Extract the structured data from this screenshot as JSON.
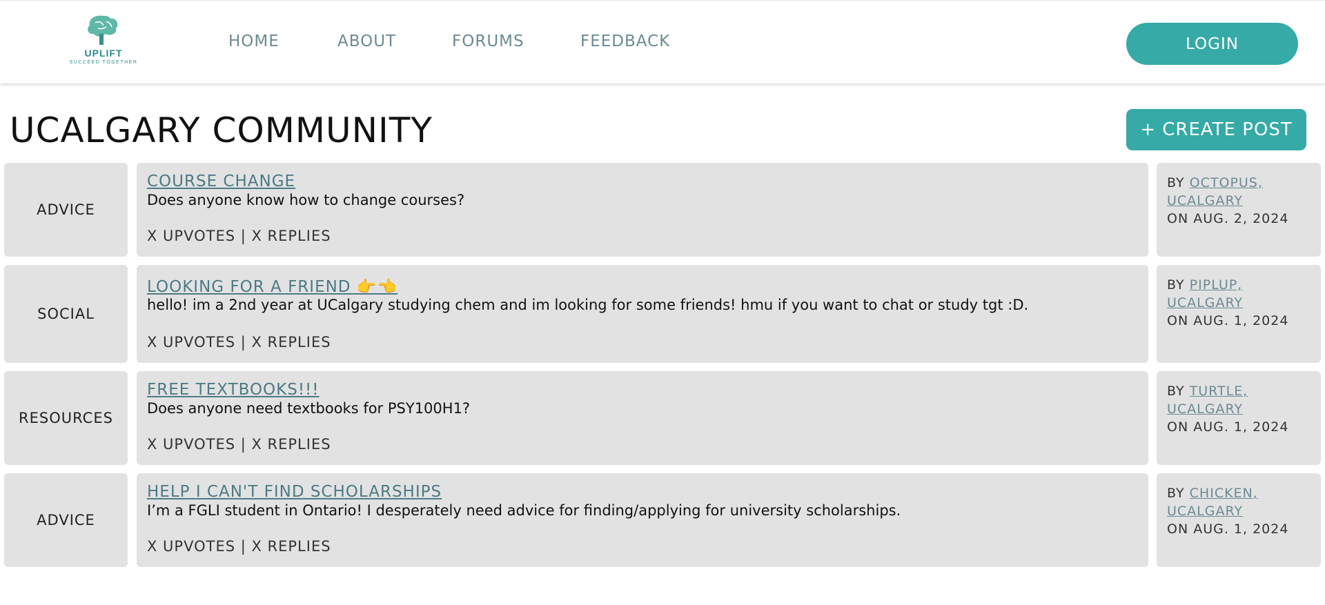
{
  "nav": {
    "logo_name": "UPLIFT",
    "logo_tagline": "SUCCEED TOGETHER",
    "links": [
      "HOME",
      "ABOUT",
      "FORUMS",
      "FEEDBACK"
    ],
    "login_label": "LOGIN"
  },
  "page": {
    "title": "UCALGARY COMMUNITY",
    "create_label": "+ CREATE POST"
  },
  "posts": [
    {
      "category": "ADVICE",
      "title": "COURSE CHANGE",
      "body": "Does anyone know how to change courses?",
      "stats": "X UPVOTES | X REPLIES",
      "by_prefix": "BY",
      "author": "OCTOPUS, UCALGARY",
      "on_prefix": "ON",
      "date": "AUG. 2, 2024"
    },
    {
      "category": "SOCIAL",
      "title": "LOOKING FOR A FRIEND 👉👈",
      "body": "hello! im a 2nd year at UCalgary studying chem and im looking for some friends! hmu if you want to chat or study tgt :D.",
      "stats": "X UPVOTES | X REPLIES",
      "by_prefix": "BY",
      "author": "PIPLUP, UCALGARY",
      "on_prefix": "ON",
      "date": "AUG. 1, 2024"
    },
    {
      "category": "RESOURCES",
      "title": "FREE TEXTBOOKS!!!",
      "body": "Does anyone need textbooks for PSY100H1?",
      "stats": "X UPVOTES | X REPLIES",
      "by_prefix": "BY",
      "author": "TURTLE, UCALGARY",
      "on_prefix": "ON",
      "date": "AUG. 1, 2024"
    },
    {
      "category": "ADVICE",
      "title": "HELP I CAN'T FIND SCHOLARSHIPS",
      "body": "I’m a FGLI student in Ontario! I desperately need advice for finding/applying for university scholarships.",
      "stats": "X UPVOTES | X REPLIES",
      "by_prefix": "BY",
      "author": "CHICKEN, UCALGARY",
      "on_prefix": "ON",
      "date": "AUG. 1, 2024"
    }
  ],
  "colors": {
    "accent": "#35aaa6",
    "card_bg": "#e2e2e2",
    "link": "#6b8a93"
  }
}
